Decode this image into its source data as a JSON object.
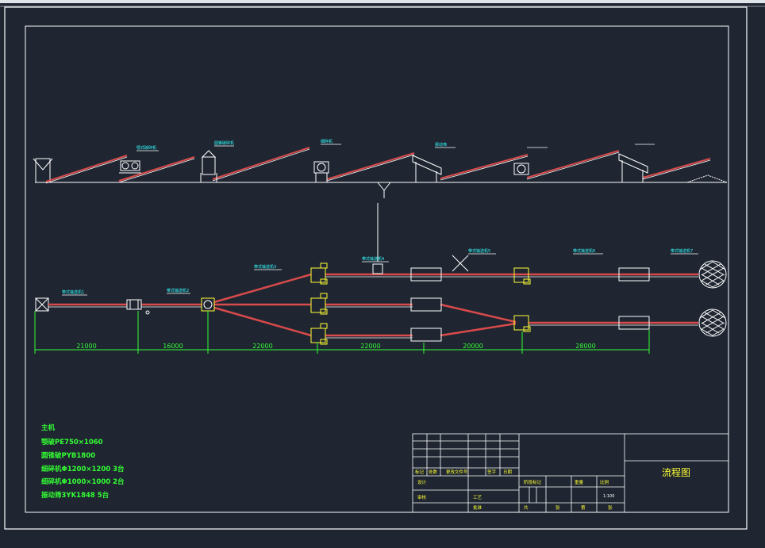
{
  "drawing": {
    "title": "流程图",
    "dimensions": [
      "21000",
      "16000",
      "22000",
      "22000",
      "20000",
      "28000"
    ],
    "notes": {
      "heading": "主机",
      "lines": [
        "颚破PE750×1060",
        "圆锥破PYB1800",
        "细碎机Φ1200×1200  3台",
        "细碎机Φ1000×1000  2台",
        "振动筛3YK1848       5台"
      ]
    },
    "title_block": {
      "row_labels": [
        "标记",
        "处数",
        "更改文件号",
        "签字",
        "日期"
      ],
      "labels_a": [
        "设计",
        "审核",
        "工艺",
        "批准"
      ],
      "labels_b": [
        "阶段标记",
        "重量",
        "比例"
      ],
      "labels_c": [
        "共",
        "张",
        "第",
        "张"
      ],
      "scale": "1:100",
      "date_label": "日期"
    },
    "callouts": [
      "带式输送机1",
      "颚式破碎机",
      "圆锥破碎机",
      "振动筛",
      "细碎机",
      "带式输送机2",
      "带式输送机3",
      "带式输送机4",
      "带式输送机5",
      "带式输送机6",
      "带式输送机7"
    ],
    "colors": {
      "background": "#1f2632",
      "frame": "#ffffff",
      "conveyor": "#d94a4a",
      "dimension": "#33ff33",
      "equipment": "#ffff33",
      "annotation": "#33ffff"
    }
  }
}
